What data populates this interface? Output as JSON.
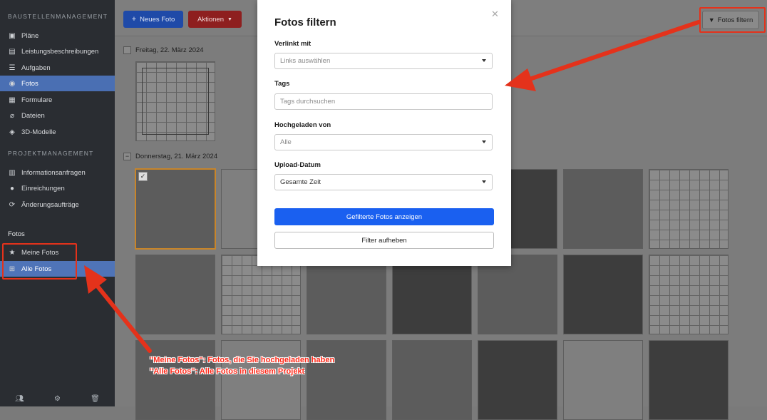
{
  "sidebar": {
    "section1_title": "BAUSTELLENMANAGEMENT",
    "section1_items": [
      {
        "label": "Pläne",
        "icon": "plan-icon"
      },
      {
        "label": "Leistungsbeschreibungen",
        "icon": "book-icon"
      },
      {
        "label": "Aufgaben",
        "icon": "list-icon"
      },
      {
        "label": "Fotos",
        "icon": "camera-icon"
      },
      {
        "label": "Formulare",
        "icon": "form-icon"
      },
      {
        "label": "Dateien",
        "icon": "paperclip-icon"
      },
      {
        "label": "3D-Modelle",
        "icon": "cube-icon"
      }
    ],
    "section2_title": "PROJEKTMANAGEMENT",
    "section2_items": [
      {
        "label": "Informationsanfragen",
        "icon": "info-icon"
      },
      {
        "label": "Einreichungen",
        "icon": "user-icon"
      },
      {
        "label": "Änderungsaufträge",
        "icon": "change-icon"
      }
    ],
    "fotos_title": "Fotos",
    "fotos_items": [
      {
        "label": "Meine Fotos",
        "icon": "star-icon"
      },
      {
        "label": "Alle Fotos",
        "icon": "grid-icon"
      }
    ]
  },
  "toolbar": {
    "new_photo_label": "Neues Foto",
    "actions_label": "Aktionen",
    "filter_label": "Fotos filtern"
  },
  "groups": [
    {
      "date": "Freitag, 22. März 2024"
    },
    {
      "date": "Donnerstag, 21. März 2024"
    }
  ],
  "modal": {
    "title": "Fotos filtern",
    "linked_label": "Verlinkt mit",
    "linked_placeholder": "Links auswählen",
    "tags_label": "Tags",
    "tags_placeholder": "Tags durchsuchen",
    "uploaded_by_label": "Hochgeladen von",
    "uploaded_by_value": "Alle",
    "upload_date_label": "Upload-Datum",
    "upload_date_value": "Gesamte Zeit",
    "apply_label": "Gefilterte Fotos anzeigen",
    "clear_label": "Filter aufheben"
  },
  "annotations": {
    "line1": "\"Meine Fotos\": Fotos, die Sie hochgeladen haben",
    "line2": "\"Alle Fotos\": Alle Fotos in diesem Projekt"
  },
  "colors": {
    "annotation_red": "#e4321b",
    "primary_blue": "#1a60f0",
    "sidebar_bg": "#2a2d32",
    "selected_photo_border": "#c8852a"
  }
}
